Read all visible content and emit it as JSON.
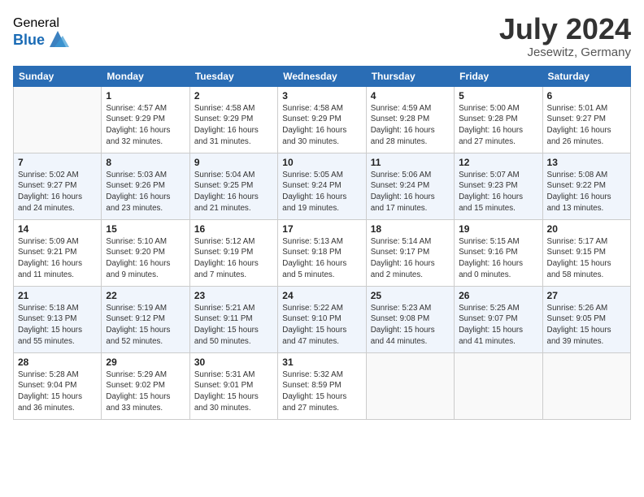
{
  "header": {
    "logo_general": "General",
    "logo_blue": "Blue",
    "month_year": "July 2024",
    "location": "Jesewitz, Germany"
  },
  "weekdays": [
    "Sunday",
    "Monday",
    "Tuesday",
    "Wednesday",
    "Thursday",
    "Friday",
    "Saturday"
  ],
  "weeks": [
    [
      {
        "day": "",
        "sunrise": "",
        "sunset": "",
        "daylight": ""
      },
      {
        "day": "1",
        "sunrise": "Sunrise: 4:57 AM",
        "sunset": "Sunset: 9:29 PM",
        "daylight": "Daylight: 16 hours and 32 minutes."
      },
      {
        "day": "2",
        "sunrise": "Sunrise: 4:58 AM",
        "sunset": "Sunset: 9:29 PM",
        "daylight": "Daylight: 16 hours and 31 minutes."
      },
      {
        "day": "3",
        "sunrise": "Sunrise: 4:58 AM",
        "sunset": "Sunset: 9:29 PM",
        "daylight": "Daylight: 16 hours and 30 minutes."
      },
      {
        "day": "4",
        "sunrise": "Sunrise: 4:59 AM",
        "sunset": "Sunset: 9:28 PM",
        "daylight": "Daylight: 16 hours and 28 minutes."
      },
      {
        "day": "5",
        "sunrise": "Sunrise: 5:00 AM",
        "sunset": "Sunset: 9:28 PM",
        "daylight": "Daylight: 16 hours and 27 minutes."
      },
      {
        "day": "6",
        "sunrise": "Sunrise: 5:01 AM",
        "sunset": "Sunset: 9:27 PM",
        "daylight": "Daylight: 16 hours and 26 minutes."
      }
    ],
    [
      {
        "day": "7",
        "sunrise": "Sunrise: 5:02 AM",
        "sunset": "Sunset: 9:27 PM",
        "daylight": "Daylight: 16 hours and 24 minutes."
      },
      {
        "day": "8",
        "sunrise": "Sunrise: 5:03 AM",
        "sunset": "Sunset: 9:26 PM",
        "daylight": "Daylight: 16 hours and 23 minutes."
      },
      {
        "day": "9",
        "sunrise": "Sunrise: 5:04 AM",
        "sunset": "Sunset: 9:25 PM",
        "daylight": "Daylight: 16 hours and 21 minutes."
      },
      {
        "day": "10",
        "sunrise": "Sunrise: 5:05 AM",
        "sunset": "Sunset: 9:24 PM",
        "daylight": "Daylight: 16 hours and 19 minutes."
      },
      {
        "day": "11",
        "sunrise": "Sunrise: 5:06 AM",
        "sunset": "Sunset: 9:24 PM",
        "daylight": "Daylight: 16 hours and 17 minutes."
      },
      {
        "day": "12",
        "sunrise": "Sunrise: 5:07 AM",
        "sunset": "Sunset: 9:23 PM",
        "daylight": "Daylight: 16 hours and 15 minutes."
      },
      {
        "day": "13",
        "sunrise": "Sunrise: 5:08 AM",
        "sunset": "Sunset: 9:22 PM",
        "daylight": "Daylight: 16 hours and 13 minutes."
      }
    ],
    [
      {
        "day": "14",
        "sunrise": "Sunrise: 5:09 AM",
        "sunset": "Sunset: 9:21 PM",
        "daylight": "Daylight: 16 hours and 11 minutes."
      },
      {
        "day": "15",
        "sunrise": "Sunrise: 5:10 AM",
        "sunset": "Sunset: 9:20 PM",
        "daylight": "Daylight: 16 hours and 9 minutes."
      },
      {
        "day": "16",
        "sunrise": "Sunrise: 5:12 AM",
        "sunset": "Sunset: 9:19 PM",
        "daylight": "Daylight: 16 hours and 7 minutes."
      },
      {
        "day": "17",
        "sunrise": "Sunrise: 5:13 AM",
        "sunset": "Sunset: 9:18 PM",
        "daylight": "Daylight: 16 hours and 5 minutes."
      },
      {
        "day": "18",
        "sunrise": "Sunrise: 5:14 AM",
        "sunset": "Sunset: 9:17 PM",
        "daylight": "Daylight: 16 hours and 2 minutes."
      },
      {
        "day": "19",
        "sunrise": "Sunrise: 5:15 AM",
        "sunset": "Sunset: 9:16 PM",
        "daylight": "Daylight: 16 hours and 0 minutes."
      },
      {
        "day": "20",
        "sunrise": "Sunrise: 5:17 AM",
        "sunset": "Sunset: 9:15 PM",
        "daylight": "Daylight: 15 hours and 58 minutes."
      }
    ],
    [
      {
        "day": "21",
        "sunrise": "Sunrise: 5:18 AM",
        "sunset": "Sunset: 9:13 PM",
        "daylight": "Daylight: 15 hours and 55 minutes."
      },
      {
        "day": "22",
        "sunrise": "Sunrise: 5:19 AM",
        "sunset": "Sunset: 9:12 PM",
        "daylight": "Daylight: 15 hours and 52 minutes."
      },
      {
        "day": "23",
        "sunrise": "Sunrise: 5:21 AM",
        "sunset": "Sunset: 9:11 PM",
        "daylight": "Daylight: 15 hours and 50 minutes."
      },
      {
        "day": "24",
        "sunrise": "Sunrise: 5:22 AM",
        "sunset": "Sunset: 9:10 PM",
        "daylight": "Daylight: 15 hours and 47 minutes."
      },
      {
        "day": "25",
        "sunrise": "Sunrise: 5:23 AM",
        "sunset": "Sunset: 9:08 PM",
        "daylight": "Daylight: 15 hours and 44 minutes."
      },
      {
        "day": "26",
        "sunrise": "Sunrise: 5:25 AM",
        "sunset": "Sunset: 9:07 PM",
        "daylight": "Daylight: 15 hours and 41 minutes."
      },
      {
        "day": "27",
        "sunrise": "Sunrise: 5:26 AM",
        "sunset": "Sunset: 9:05 PM",
        "daylight": "Daylight: 15 hours and 39 minutes."
      }
    ],
    [
      {
        "day": "28",
        "sunrise": "Sunrise: 5:28 AM",
        "sunset": "Sunset: 9:04 PM",
        "daylight": "Daylight: 15 hours and 36 minutes."
      },
      {
        "day": "29",
        "sunrise": "Sunrise: 5:29 AM",
        "sunset": "Sunset: 9:02 PM",
        "daylight": "Daylight: 15 hours and 33 minutes."
      },
      {
        "day": "30",
        "sunrise": "Sunrise: 5:31 AM",
        "sunset": "Sunset: 9:01 PM",
        "daylight": "Daylight: 15 hours and 30 minutes."
      },
      {
        "day": "31",
        "sunrise": "Sunrise: 5:32 AM",
        "sunset": "Sunset: 8:59 PM",
        "daylight": "Daylight: 15 hours and 27 minutes."
      },
      {
        "day": "",
        "sunrise": "",
        "sunset": "",
        "daylight": ""
      },
      {
        "day": "",
        "sunrise": "",
        "sunset": "",
        "daylight": ""
      },
      {
        "day": "",
        "sunrise": "",
        "sunset": "",
        "daylight": ""
      }
    ]
  ]
}
